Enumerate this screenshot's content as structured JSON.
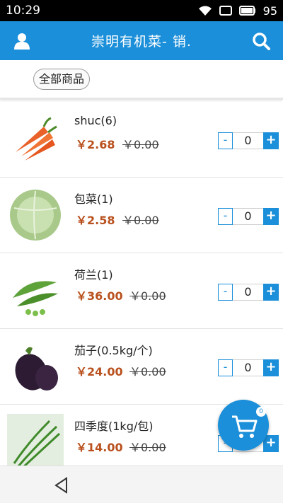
{
  "status_bar": {
    "time": "10:29",
    "battery": "95",
    "icons": [
      "wifi-icon",
      "window-icon",
      "battery-icon"
    ]
  },
  "header": {
    "title": "崇明有机菜- 销.",
    "left_icon": "user-icon",
    "right_icon": "search-icon",
    "color": "#1b8fd9"
  },
  "category": {
    "label": "全部商品"
  },
  "products": [
    {
      "name": "shuc(6)",
      "price": "￥2.68",
      "original_price": "￥0.00",
      "quantity": "0",
      "image": "carrot"
    },
    {
      "name": "包菜(1)",
      "price": "￥2.58",
      "original_price": "￥0.00",
      "quantity": "0",
      "image": "cabbage"
    },
    {
      "name": "荷兰(1)",
      "price": "￥36.00",
      "original_price": "￥0.00",
      "quantity": "0",
      "image": "peas"
    },
    {
      "name": "茄子(0.5kg/个)",
      "price": "￥24.00",
      "original_price": "￥0.00",
      "quantity": "0",
      "image": "eggplant"
    },
    {
      "name": "四季度(1kg/包)",
      "price": "￥14.00",
      "original_price": "￥0.00",
      "quantity": "",
      "image": "green-beans"
    }
  ],
  "stepper": {
    "minus": "-",
    "plus": "+"
  },
  "cart": {
    "badge": "0",
    "icon": "cart-icon"
  },
  "nav_bar": {
    "back_icon": "back-triangle-icon"
  },
  "colors": {
    "accent": "#1b8fd9",
    "price": "#b9501d"
  }
}
